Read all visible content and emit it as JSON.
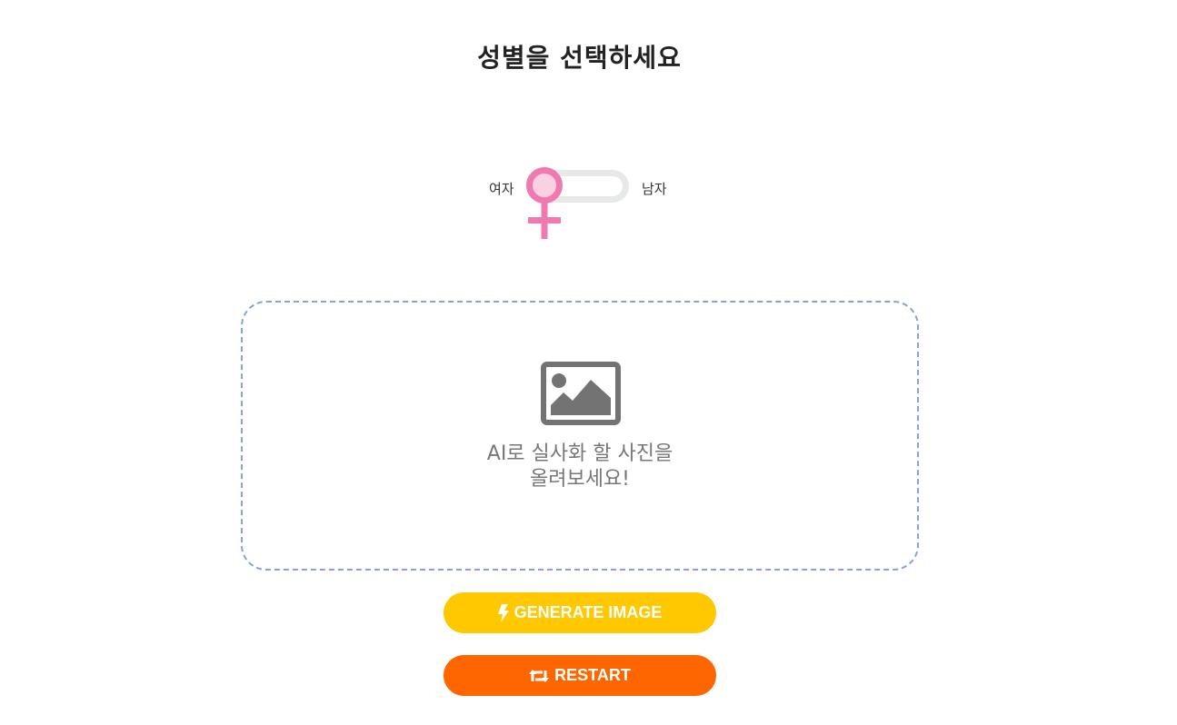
{
  "header": {
    "title": "성별을 선택하세요"
  },
  "gender_toggle": {
    "left_label": "여자",
    "right_label": "남자",
    "selected": "여자",
    "indicator_icon": "female-symbol-icon",
    "indicator_color": "#f07ab0",
    "track_color": "#e6e9e8"
  },
  "upload": {
    "icon": "image-icon",
    "line1": "AI로 실사화 할 사진을",
    "line2": "올려보세요!",
    "border_color": "#8b9fdb"
  },
  "buttons": {
    "generate": {
      "label": "GENERATE IMAGE",
      "icon": "lightning-bolt-icon",
      "color": "#ffc800"
    },
    "restart": {
      "label": "RESTART",
      "icon": "retweet-arrows-icon",
      "color": "#ff6600"
    }
  }
}
